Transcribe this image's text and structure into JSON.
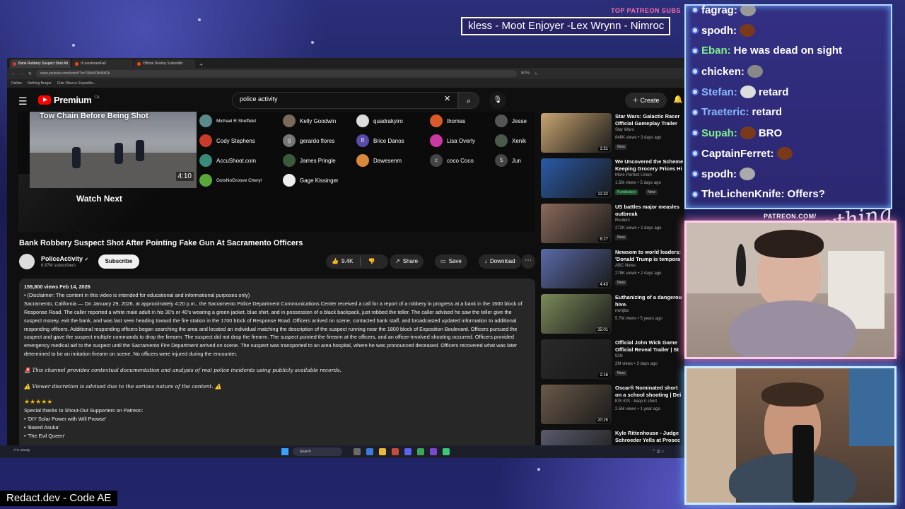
{
  "overlay": {
    "patreon_label": "TOP PATREON SUBS",
    "subs_ticker": "kless - Moot Enjoyer -Lex Wrynn - Nimroc",
    "patreon_url": "PATREON.COM/",
    "signature": "Anything else?",
    "bottom_label": "Redact.dev - Code AE"
  },
  "browser": {
    "tabs": [
      {
        "label": "Bank Robbery Suspect Shot Aft",
        "active": true
      },
      {
        "label": "r/LivestreamFail",
        "active": false
      },
      {
        "label": "Official Destiny Subreddit",
        "active": false
      }
    ],
    "new_tab": "+",
    "url": "www.youtube.com/watch?v=7A8cK0lhWdRk",
    "zoom": "80%",
    "bookmarks": [
      "Dailies",
      "Nothing Burger",
      "Clair Obscur: Expeditio..."
    ]
  },
  "youtube": {
    "logo_text": "Premium",
    "logo_sup": "CA",
    "search_value": "police activity",
    "create_label": "Create"
  },
  "player": {
    "watchnext_title": "Tow Chain Before Being Shot",
    "watchnext_duration": "4:10",
    "watchnext_label": "Watch Next",
    "supporters": [
      {
        "name": "Michael R Sheffield",
        "color": "#5b8a8a",
        "initial": ""
      },
      {
        "name": "Kelly Goodwin",
        "color": "#7a6a5a",
        "initial": ""
      },
      {
        "name": "quadrakyiro",
        "color": "#dddddd",
        "initial": ""
      },
      {
        "name": "thomas",
        "color": "#d85a2a",
        "initial": ""
      },
      {
        "name": "Jesse",
        "color": "#555555",
        "initial": ""
      },
      {
        "name": "Cody Stephens",
        "color": "#c83a2a",
        "initial": ""
      },
      {
        "name": "gerardo flores",
        "color": "#777777",
        "initial": "g"
      },
      {
        "name": "Brice Danos",
        "color": "#5a4aaa",
        "initial": "B"
      },
      {
        "name": "Lisa Overly",
        "color": "#c83aa0",
        "initial": ""
      },
      {
        "name": "Xenik",
        "color": "#4a5a4a",
        "initial": ""
      },
      {
        "name": "AccuShoot.com",
        "color": "#3a8a7a",
        "initial": ""
      },
      {
        "name": "James Pringle",
        "color": "#3a5a3a",
        "initial": ""
      },
      {
        "name": "Dawesenm",
        "color": "#d88a3a",
        "initial": ""
      },
      {
        "name": "coco Coco",
        "color": "#444444",
        "initial": "c"
      },
      {
        "name": "Jun",
        "color": "#444444",
        "initial": "S"
      },
      {
        "name": "GotsNoGroove Cheryl",
        "color": "#5aa83a",
        "initial": ""
      },
      {
        "name": "Gage Kissinger",
        "color": "#eeeeee",
        "initial": ""
      }
    ]
  },
  "video": {
    "title": "Bank Robbery Suspect Shot After Pointing Fake Gun At Sacramento Officers",
    "channel": "PoliceActivity",
    "subscribers": "6.87M subscribers",
    "subscribe_label": "Subscribe",
    "likes": "9.4K",
    "share_label": "Share",
    "save_label": "Save",
    "download_label": "Download",
    "description": {
      "meta": "159,800 views  Feb 14, 2026",
      "disclaimer": "• (Disclaimer: The content in this video is intended for educational and informational purposes only)",
      "body": "Sacramento, California — On January 29, 2026, at approximately 4:20 p.m., the Sacramento Police Department Communications Center received a call for a report of a robbery in progress at a bank in the 1600 block of Response Road. The caller reported a white male adult in his 30's or 40's wearing a green jacket, blue shirt, and in possession of a black backpack, just robbed the teller. The caller advised he saw the teller give the suspect money, exit the bank, and was last seen heading toward the fire station in the 1700 block of Response Road. Officers arrived on scene, contacted bank staff, and broadcasted updated information to additional responding officers. Additional responding officers began searching the area and located an individual matching the description of the suspect running near the 1800 block of Exposition Boulevard. Officers pursued the suspect and gave the suspect multiple commands to drop the firearm. The suspect did not drop the firearm. The suspect pointed the firearm at the officers, and an officer-involved shooting occurred. Officers provided emergency medical aid to the suspect until the Sacramento Fire Department arrived on scene. The suspect was transported to an area hospital, where he was pronounced deceased. Officers recovered what was later determined to be an imitation firearm on scene. No officers were injured during the encounter.",
      "contextual": "🚨 This channel provides contextual documentation and analysis of real police incidents using publicly available records.",
      "discretion": "⚠️ Viewer discretion is advised due to the serious nature of the content. ⚠️",
      "stars": "★★★★★",
      "thanks": "Special thanks to Shout-Out Supporters on Patreon:",
      "shoutouts": [
        "• 'DIY Solar Power with Will Prowse'",
        "• 'Based Asuka'",
        "• 'The Evil Queen'"
      ]
    }
  },
  "recommendations": [
    {
      "title": "Star Wars: Galactic Racer",
      "title2": "Official Gameplay Trailer",
      "channel": "Star Wars",
      "meta": "848K views • 3 days ago",
      "duration": "1:31",
      "badge": "New",
      "color": "#c8a470"
    },
    {
      "title": "We Uncovered the Scheme",
      "title2": "Keeping Grocery Prices Hi",
      "channel": "More Perfect Union",
      "meta": "1.5M views • 5 days ago",
      "duration": "11:32",
      "badge": "Fundraiser",
      "badge2": "New",
      "color": "#2a5aa8"
    },
    {
      "title": "US battles major measles",
      "title2": "outbreak",
      "channel": "Reuters",
      "meta": "272K views • 2 days ago",
      "duration": "6:27",
      "badge": "New",
      "color": "#8a6a5a"
    },
    {
      "title": "Newsom to world leaders:",
      "title2": "'Donald Trump is tempora",
      "channel": "ABC News",
      "meta": "278K views • 2 days ago",
      "duration": "4:43",
      "badge": "New",
      "color": "#5a6aa8"
    },
    {
      "title": "Euthanizing of a dangerou",
      "title2": "hive.",
      "channel": "nwnjba",
      "meta": "5.7M views • 5 years ago",
      "duration": "35:01",
      "badge": "",
      "color": "#7a8a5a"
    },
    {
      "title": "Official John Wick Game",
      "title2": "Official Reveal Trailer | St",
      "channel": "IGN",
      "meta": "2M views • 3 days ago",
      "duration": "2:16",
      "badge": "New",
      "color": "#2a2a2a"
    },
    {
      "title": "Oscar® Nominated short",
      "title2": "on a school shooting | Dei",
      "channel": "KIS KIS - keep it short",
      "meta": "2.5M views • 1 year ago",
      "duration": "20:25",
      "badge": "",
      "color": "#6a5a4a"
    },
    {
      "title": "Kyle Rittenhouse - Judge",
      "title2": "Schroeder Yells at Prosec",
      "channel": "",
      "meta": "",
      "duration": "",
      "badge": "",
      "color": "#5a5a6a"
    }
  ],
  "taskbar": {
    "weather": "-7°C Cloudy",
    "search": "Search"
  },
  "chat": [
    {
      "user": "fagrag:",
      "msg": "",
      "color": "#ffffff",
      "emote": "#999999"
    },
    {
      "user": "spodh:",
      "msg": "",
      "color": "#ffffff",
      "emote": "#7a3a1a"
    },
    {
      "user": "Eban:",
      "msg": "He was dead on sight",
      "color": "#7ef08a",
      "emote": ""
    },
    {
      "user": "chicken:",
      "msg": "",
      "color": "#ffffff",
      "emote": "#888888"
    },
    {
      "user": "Stefan:",
      "msg": "retard",
      "color": "#88b8ff",
      "emote": "#dddddd"
    },
    {
      "user": "Traeteric:",
      "msg": "retard",
      "color": "#88b8ff",
      "emote": ""
    },
    {
      "user": "Supah:",
      "msg": "BRO",
      "color": "#7ef08a",
      "emote": "#7a3a1a"
    },
    {
      "user": "CaptainFerret:",
      "msg": "",
      "color": "#ffffff",
      "emote": "#7a3a1a"
    },
    {
      "user": "spodh:",
      "msg": "",
      "color": "#ffffff",
      "emote": "#aaaaaa"
    },
    {
      "user": "TheLichenKnife:",
      "msg": "Offers?",
      "color": "#ffffff",
      "emote": ""
    }
  ]
}
